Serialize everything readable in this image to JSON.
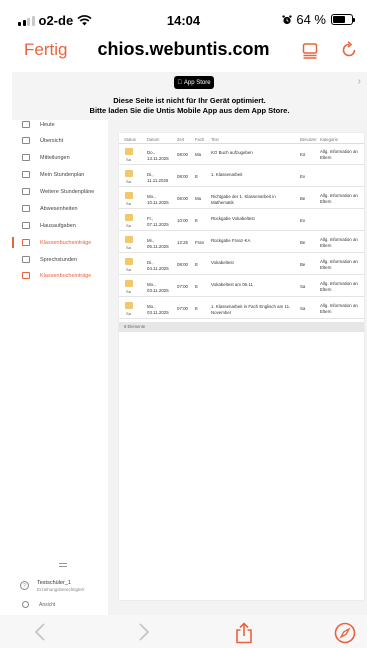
{
  "status_bar": {
    "carrier": "o2-de",
    "time": "14:04",
    "battery": "64 %",
    "battery_level": 0.64
  },
  "nav": {
    "done_label": "Fertig",
    "url": "chios.webuntis.com"
  },
  "banner": {
    "badge": "App Store",
    "line1": "Diese Seite ist nicht für Ihr Gerät optimiert.",
    "line2": "Bitte laden Sie die Untis Mobile App aus dem App Store."
  },
  "sidebar": {
    "items": [
      {
        "label": "Heute"
      },
      {
        "label": "Übersicht"
      },
      {
        "label": "Mitteilungen"
      },
      {
        "label": "Mein Stundenplan"
      },
      {
        "label": "Weitere Stundenpläne"
      },
      {
        "label": "Abwesenheiten"
      },
      {
        "label": "Hausaufgaben"
      },
      {
        "label": "Klassenbucheinträge"
      },
      {
        "label": "Sprechstunden"
      },
      {
        "label": "Klassenbucheinträge"
      }
    ],
    "user_name": "Testschüler_1",
    "user_role": "Erziehungsberechtigte/r",
    "collapse_label": "Ansicht"
  },
  "table": {
    "headers": [
      "Status",
      "Datum",
      "Zeit",
      "Fach",
      "Text",
      "Benutzer",
      "Kategorie"
    ],
    "rows": [
      {
        "status": "Sa",
        "date": "Do., 13.11.2025",
        "time": "08:00",
        "subject": "Ma",
        "text": "KO Buch aufzugeben",
        "teacher": "Kö",
        "category": "Allg. Information an Eltern"
      },
      {
        "status": "Sa",
        "date": "Di., 11.11.2025",
        "time": "08:00",
        "subject": "E",
        "text": "1. Klassenarbeit",
        "teacher": "Ev",
        "category": ""
      },
      {
        "status": "Sa",
        "date": "Mo., 10.11.2025",
        "time": "08:00",
        "subject": "Ma",
        "text": "Richtgabe der 1. Klassenarbeit in Mathematik",
        "teacher": "Be",
        "category": "Allg. Information an Eltern"
      },
      {
        "status": "Sa",
        "date": "Fr., 07.11.2025",
        "time": "10:00",
        "subject": "E",
        "text": "Rückgabe Vokabeltest",
        "teacher": "Ev",
        "category": ""
      },
      {
        "status": "Sa",
        "date": "Mi., 05.11.2025",
        "time": "12:25",
        "subject": "Fran",
        "text": "Rückgabe Franz-KA",
        "teacher": "Be",
        "category": "Allg. Information an Eltern"
      },
      {
        "status": "Sa",
        "date": "Di., 04.11.2025",
        "time": "08:00",
        "subject": "E",
        "text": "Vokabeltest",
        "teacher": "Be",
        "category": "Allg. Information an Eltern"
      },
      {
        "status": "Sa",
        "date": "Mo., 03.11.2025",
        "time": "07:00",
        "subject": "E",
        "text": "Vokabeltest am 06.11",
        "teacher": "Sa",
        "category": "Allg. Information an Eltern"
      },
      {
        "status": "Sa",
        "date": "Mo., 03.11.2025",
        "time": "07:00",
        "subject": "E",
        "text": "1. Klassenarbeit in Fach Englisch am 11. November",
        "teacher": "Sa",
        "category": "Allg. Information an Eltern"
      }
    ],
    "footer": "8 Elemente"
  }
}
